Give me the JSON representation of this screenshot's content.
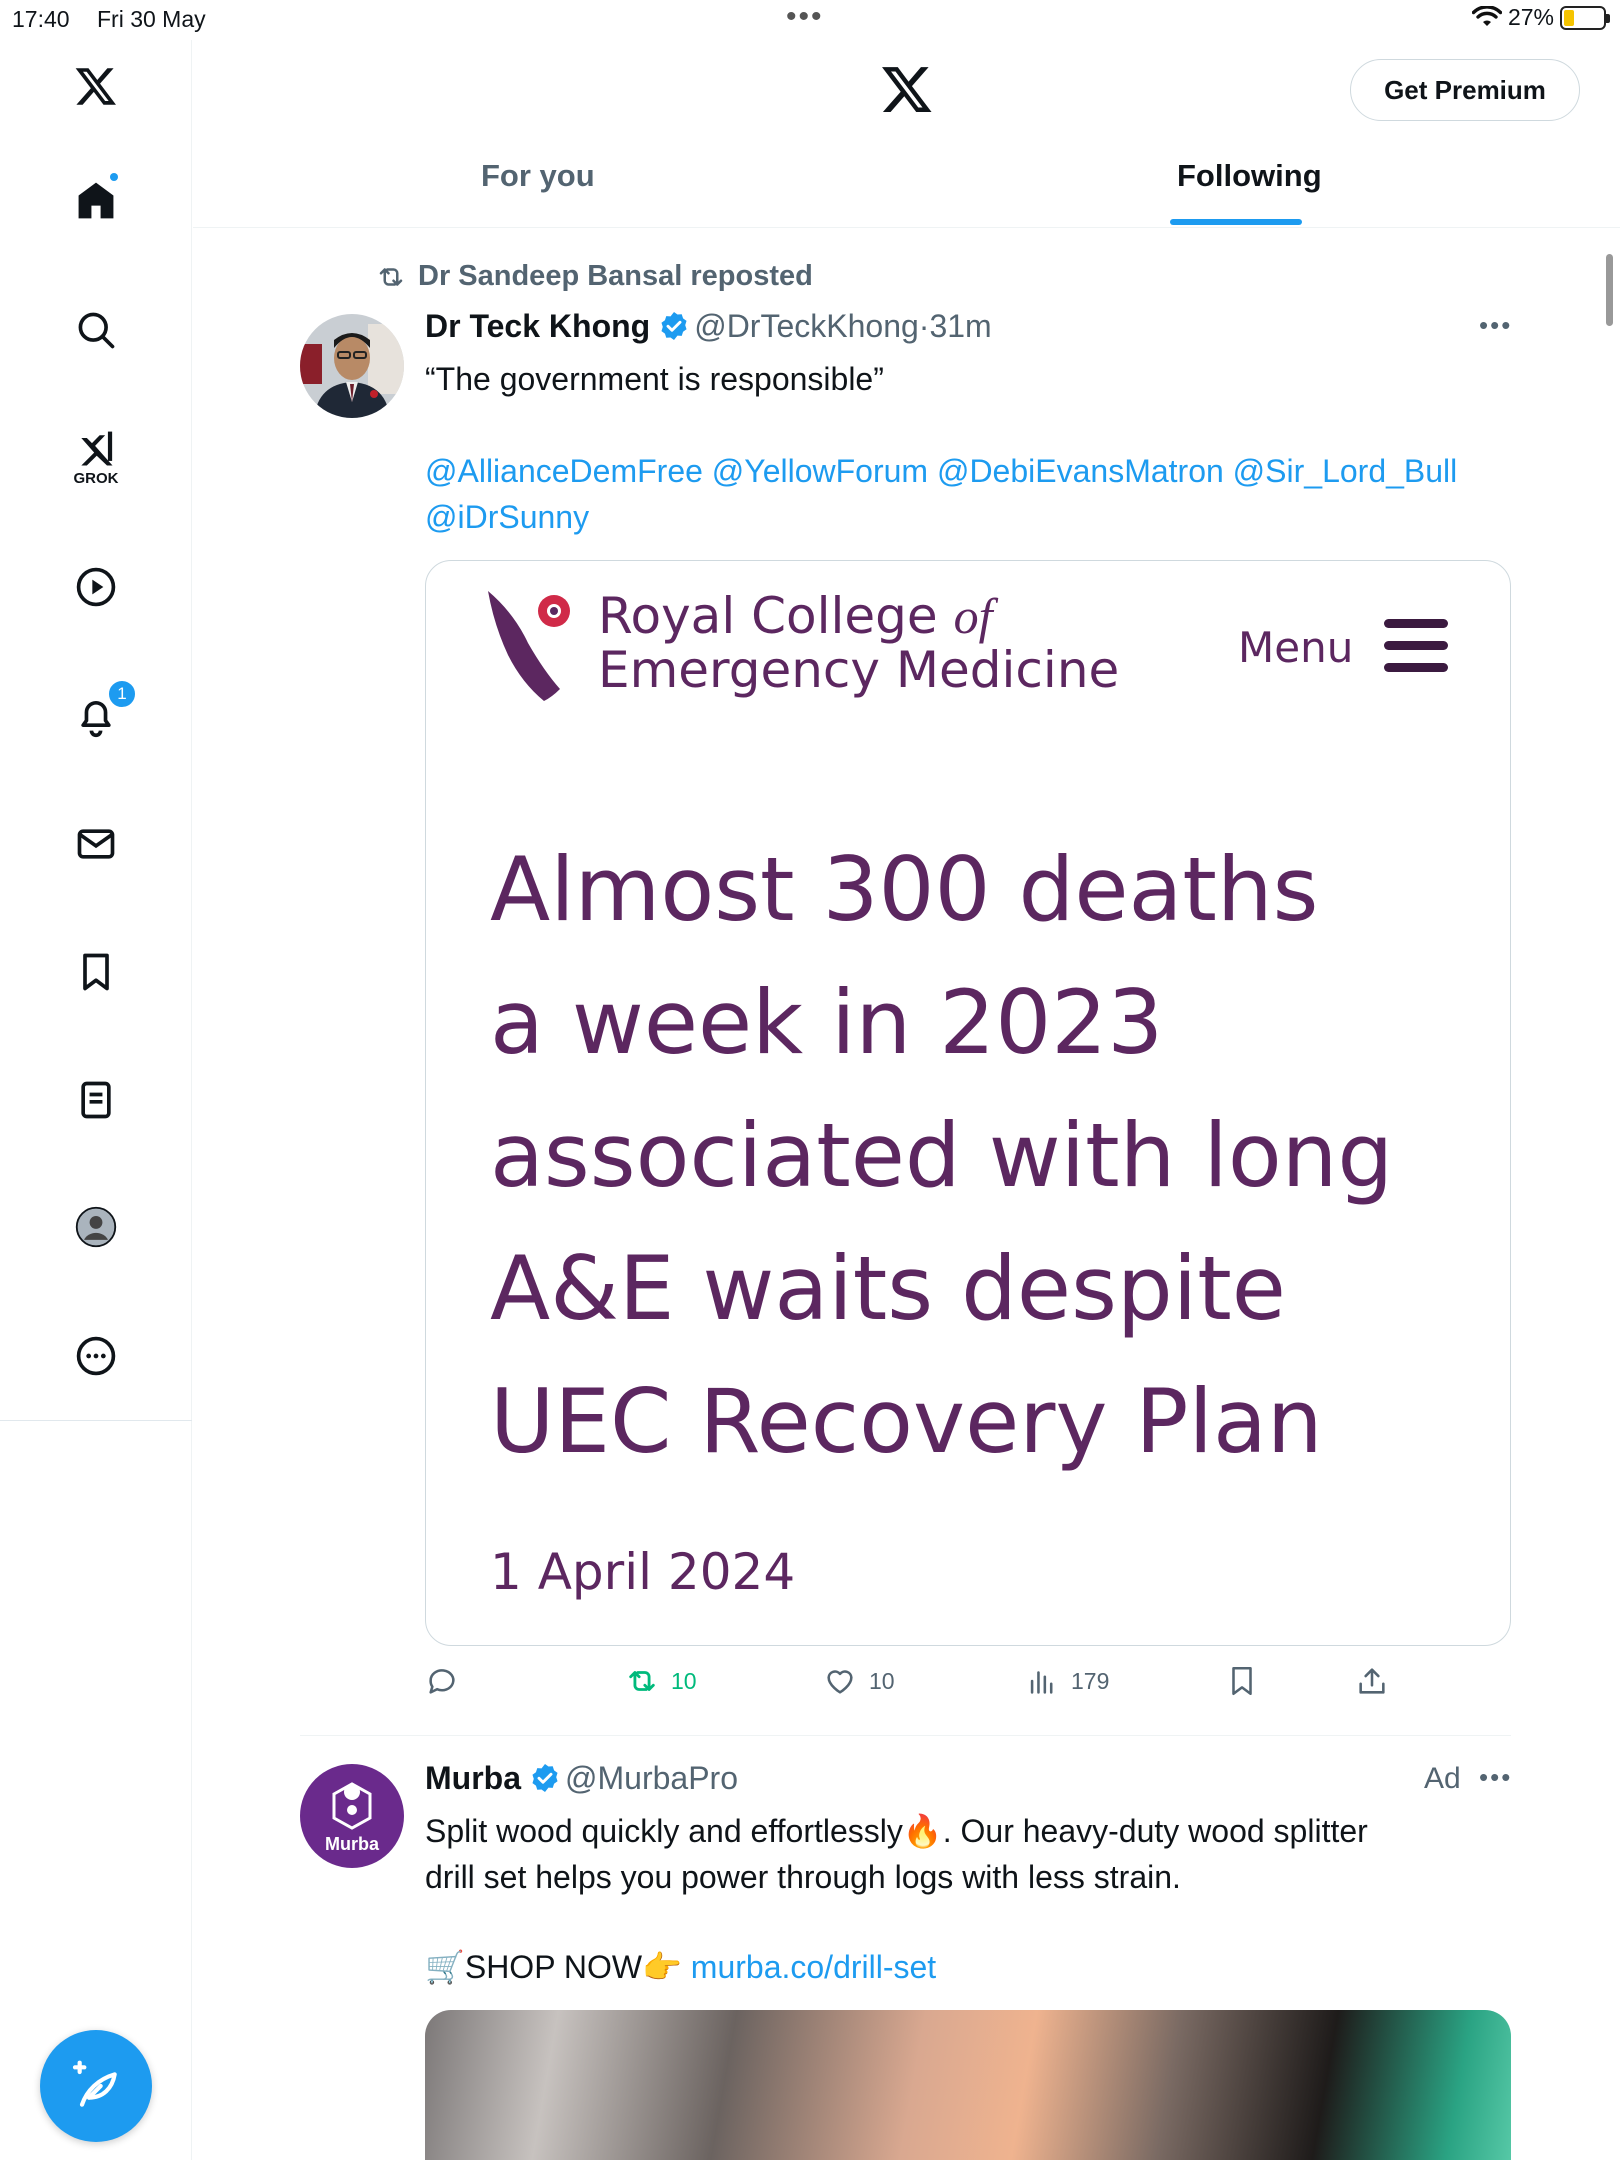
{
  "status_bar": {
    "time": "17:40",
    "date": "Fri 30 May",
    "battery": "27%",
    "battery_level": 0.27
  },
  "sidebar": {
    "grok_label": "GROK",
    "notifications_badge": "1",
    "icons": [
      "x-logo-icon",
      "home-icon",
      "search-icon",
      "grok-icon",
      "video-icon",
      "bell-icon",
      "mail-icon",
      "bookmark-icon",
      "lists-icon",
      "profile-icon",
      "more-icon"
    ]
  },
  "header": {
    "premium_label": "Get Premium",
    "tabs": [
      {
        "label": "For you",
        "active": false
      },
      {
        "label": "Following",
        "active": true
      }
    ]
  },
  "tweet1": {
    "repost_text": "Dr Sandeep Bansal reposted",
    "name": "Dr Teck Khong",
    "handle": "@DrTeckKhong",
    "time": "31m",
    "text": "“The government is responsible”",
    "mentions_line1": "@AllianceDemFree @YellowForum @DebiEvansMatron @Sir_Lord_Bull",
    "mentions_line2": "@iDrSunny",
    "card": {
      "org_line1": "Royal College",
      "org_of": "of",
      "org_line2": "Emergency Medicine",
      "menu_label": "Menu",
      "headline_lines": [
        "Almost 300 deaths",
        "a week in 2023",
        "associated with long",
        "A&E waits despite",
        "UEC Recovery Plan"
      ],
      "date": "1 April 2024",
      "accent_color": "#5c2760"
    },
    "stats": {
      "reposts": "10",
      "likes": "10",
      "views": "179"
    }
  },
  "tweet2": {
    "name": "Murba",
    "handle": "@MurbaPro",
    "ad_label": "Ad",
    "avatar_text": "Murba",
    "text_line1": "Split wood quickly and effortlessly🔥. Our heavy-duty wood splitter",
    "text_line2": "drill set helps you power through logs with less strain.",
    "shop_text": "🛒SHOP NOW👉",
    "shop_link": "murba.co/drill-set"
  },
  "colors": {
    "accent": "#1d9bf0",
    "repost_green": "#00ba7c",
    "murba_purple": "#6a2a8c"
  }
}
